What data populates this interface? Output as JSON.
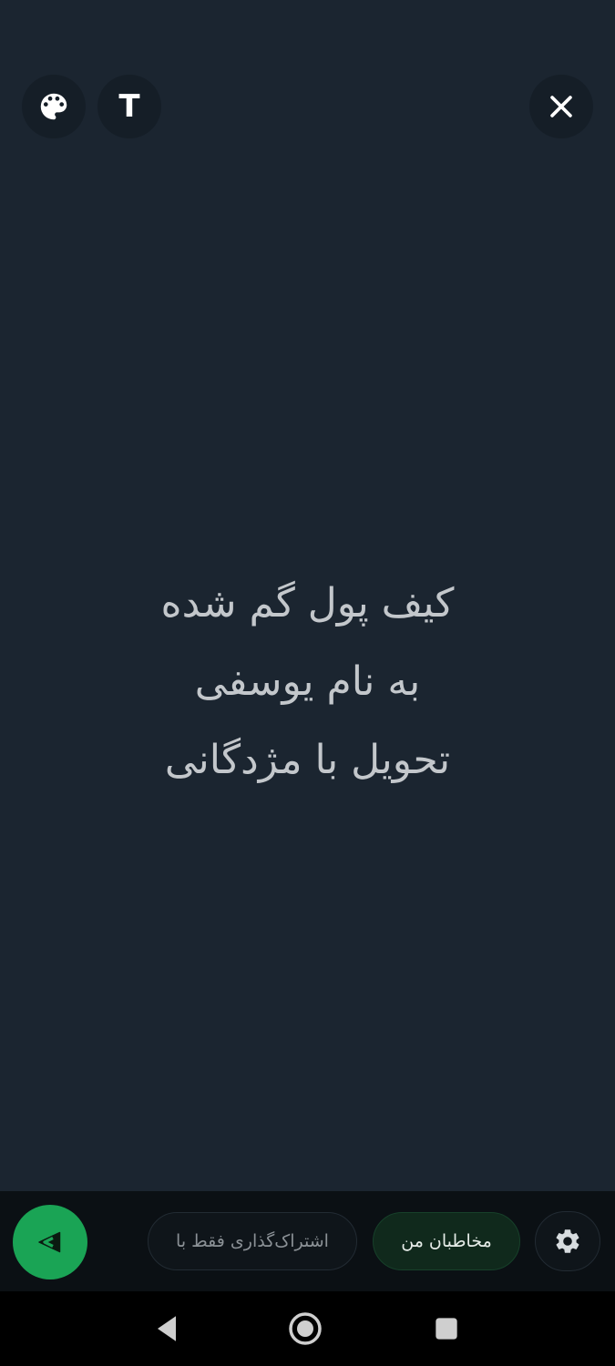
{
  "top_bar": {
    "palette_icon": "palette-icon",
    "text_button_label": "T",
    "close_icon": "close-icon"
  },
  "status": {
    "lines": [
      "کیف پول گم شده",
      "به نام یوسفی",
      "تحویل با مژدگانی"
    ],
    "text_color": "#c3c7cb",
    "background_color": "#1b2530"
  },
  "bottom_bar": {
    "send_icon": "send-icon",
    "share_only_with_label": "اشتراک‌گذاری فقط با",
    "my_contacts_label": "مخاطبان من",
    "settings_icon": "gear-icon",
    "accent_color": "#1aa455"
  },
  "nav": {
    "back_icon": "back-icon",
    "home_icon": "home-icon",
    "recents_icon": "recents-icon"
  }
}
